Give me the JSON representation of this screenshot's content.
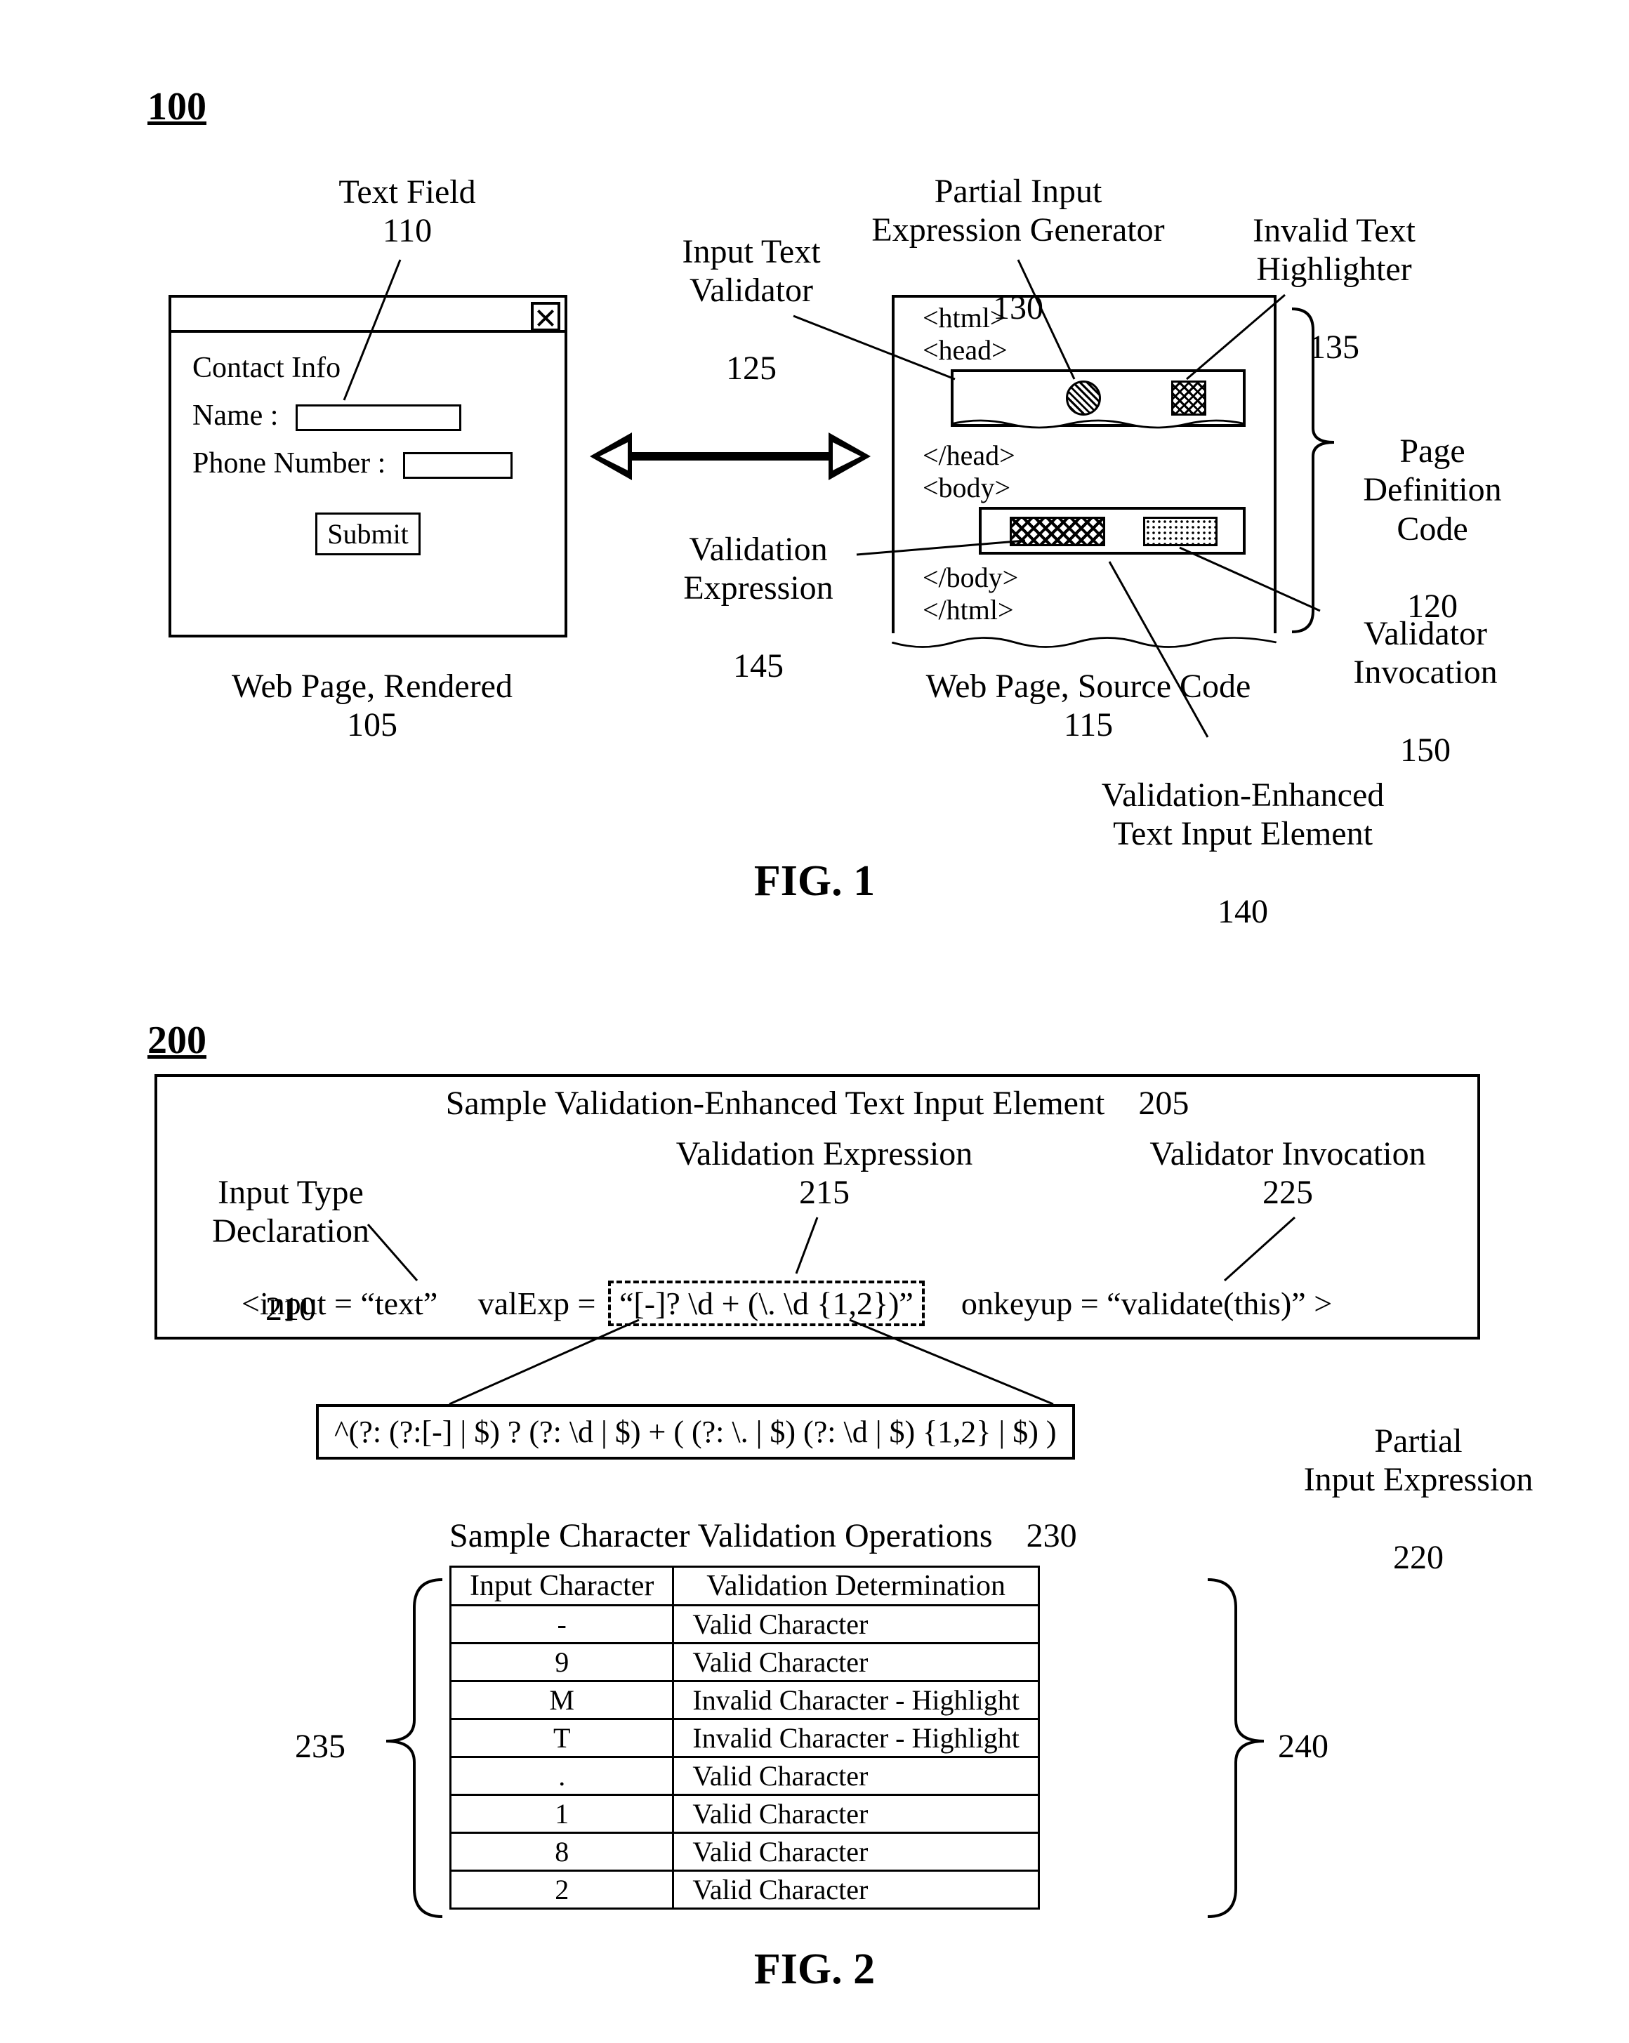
{
  "fig1": {
    "ref100": "100",
    "labels": {
      "textField": "Text Field",
      "textFieldNum": "110",
      "inputValidator": "Input Text\nValidator",
      "inputValidatorNum": "125",
      "partialGen": "Partial Input\nExpression Generator",
      "partialGenNum": "130",
      "invalidHighlighter": "Invalid Text\nHighlighter",
      "invalidHighlighterNum": "135",
      "valExpr": "Validation\nExpression",
      "valExprNum": "145",
      "pageDef": "Page\nDefinition\nCode",
      "pageDefNum": "120",
      "validatorInv": "Validator\nInvocation",
      "validatorInvNum": "150",
      "enhancedInput": "Validation-Enhanced\nText Input Element",
      "enhancedInputNum": "140",
      "renderedCaption": "Web Page, Rendered",
      "renderedNum": "105",
      "sourceCaption": "Web Page, Source Code",
      "sourceNum": "115"
    },
    "window": {
      "heading": "Contact Info",
      "nameLabel": "Name :",
      "phoneLabel": "Phone Number :",
      "submit": "Submit"
    },
    "source": {
      "l1": "<html>",
      "l2": "<head>",
      "l3": "</head>",
      "l4": "<body>",
      "l5": "</body>",
      "l6": "</html>"
    },
    "figTitle": "FIG. 1"
  },
  "fig2": {
    "ref200": "200",
    "title": "Sample Validation-Enhanced Text Input Element",
    "titleNum": "205",
    "inputTypeDecl": "Input Type\nDeclaration",
    "inputTypeDeclNum": "210",
    "valExprLbl": "Validation Expression",
    "valExprLblNum": "215",
    "validatorInvLbl": "Validator Invocation",
    "validatorInvLblNum": "225",
    "code": {
      "seg1": "<input = “text”",
      "seg2": "valExp =",
      "seg3": "“[-]? \\d + (\\. \\d {1,2})”",
      "seg4": "onkeyup = “validate(this)” >"
    },
    "partialExpr": "^(?: (?:[-] | $) ? (?: \\d | $) + ( (?: \\. | $) (?: \\d | $) {1,2} | $) )",
    "partialExprLbl": "Partial\nInput Expression",
    "partialExprLblNum": "220",
    "tableTitle": "Sample Character Validation Operations",
    "tableTitleNum": "230",
    "col1": "Input Character",
    "col2": "Validation Determination",
    "rows": [
      {
        "ch": "-",
        "det": "Valid Character"
      },
      {
        "ch": "9",
        "det": "Valid Character"
      },
      {
        "ch": "M",
        "det": "Invalid Character - Highlight"
      },
      {
        "ch": "T",
        "det": "Invalid Character - Highlight"
      },
      {
        "ch": ".",
        "det": "Valid Character"
      },
      {
        "ch": "1",
        "det": "Valid Character"
      },
      {
        "ch": "8",
        "det": "Valid Character"
      },
      {
        "ch": "2",
        "det": "Valid Character"
      }
    ],
    "leftBraceNum": "235",
    "rightBraceNum": "240",
    "figTitle": "FIG. 2"
  }
}
